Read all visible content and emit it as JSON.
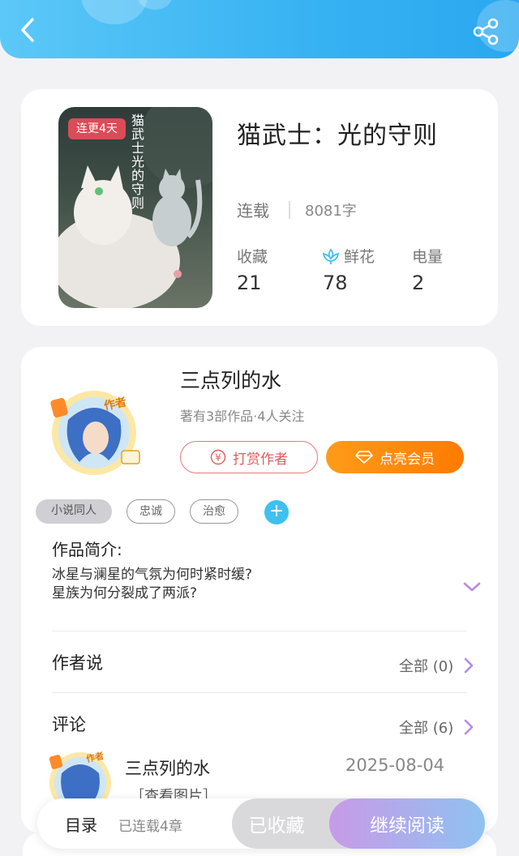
{
  "header": {
    "back_icon": "chevron-left-icon",
    "share_icon": "share-icon"
  },
  "book": {
    "badge": "连更4天",
    "cover_title": "猫武士光的守则",
    "title": "猫武士：光的守则",
    "status": "连载",
    "words": "8081字",
    "stats": [
      {
        "label": "收藏",
        "value": "21"
      },
      {
        "label": "鲜花",
        "value": "78",
        "icon": "flower-icon"
      },
      {
        "label": "电量",
        "value": "2"
      }
    ]
  },
  "author": {
    "name": "三点列的水",
    "meta": "著有3部作品·4人关注",
    "avatar_badge": "作者",
    "tip_label": "打赏作者",
    "vip_label": "点亮会员",
    "tags": [
      "小说同人",
      "忠诚",
      "治愈"
    ],
    "tag_add": "+"
  },
  "intro": {
    "label": "作品简介:",
    "lines": [
      "冰星与澜星的气氛为何时紧时缓?",
      "星族为何分裂成了两派?"
    ]
  },
  "author_says": {
    "title": "作者说",
    "more": "全部 (0)"
  },
  "comments": {
    "title": "评论",
    "more": "全部 (6)",
    "first": {
      "user": "三点列的水",
      "date": "2025-08-04",
      "text": "［查看图片］",
      "avatar_badge": "作者"
    }
  },
  "bottom_bar": {
    "toc": "目录",
    "toc_count": "已连载4章",
    "fav": "已收藏",
    "read": "继续阅读"
  },
  "colors": {
    "header": "#37b2f2",
    "accent_orange": "#ff8a00",
    "tip_red": "#e25c5c",
    "tag_add": "#3ec1ef",
    "chevron_purple": "#b68be6"
  }
}
